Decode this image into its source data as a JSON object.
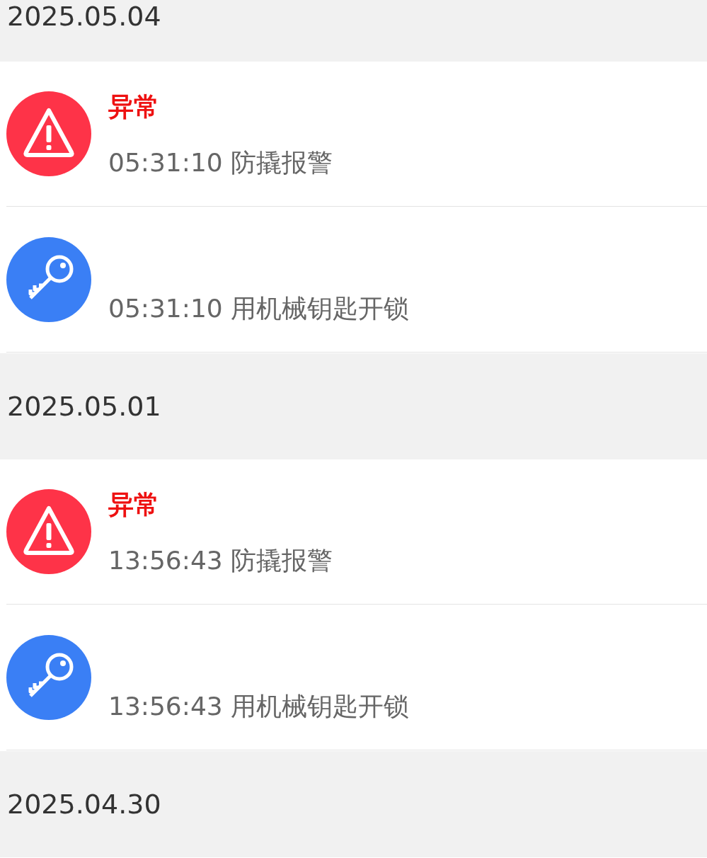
{
  "groups": [
    {
      "date": "2025.05.04",
      "events": [
        {
          "kind": "alarm",
          "label": "异常",
          "text": "05:31:10 防撬报警"
        },
        {
          "kind": "key",
          "text": "05:31:10 用机械钥匙开锁"
        }
      ]
    },
    {
      "date": "2025.05.01",
      "events": [
        {
          "kind": "alarm",
          "label": "异常",
          "text": "13:56:43 防撬报警"
        },
        {
          "kind": "key",
          "text": "13:56:43 用机械钥匙开锁"
        }
      ]
    },
    {
      "date": "2025.04.30"
    }
  ]
}
